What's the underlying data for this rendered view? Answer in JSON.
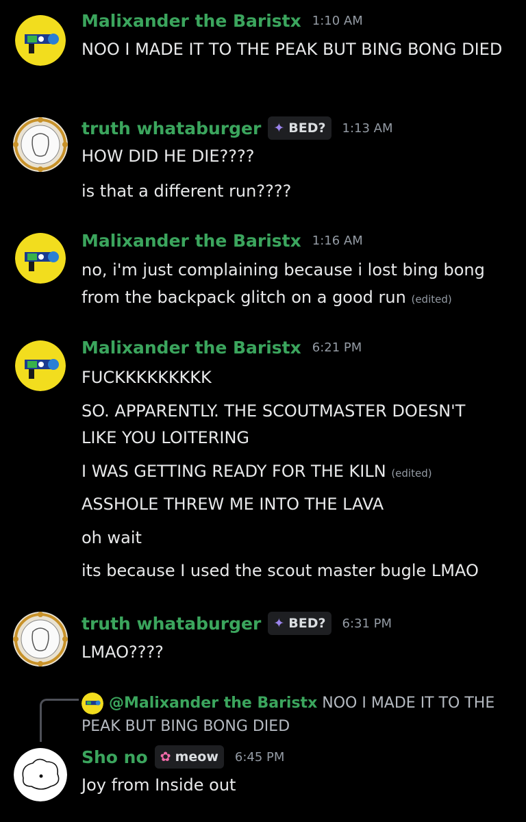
{
  "colors": {
    "background": "#000000",
    "username": "#3ba55d",
    "timestamp": "#949ba4",
    "text": "#e8e9ea",
    "tag_bg": "#1e1f22"
  },
  "messages": [
    {
      "author": "Malixander the Baristx",
      "time": "1:10 AM",
      "lines": [
        "NOO I MADE IT TO THE PEAK BUT BING BONG DIED"
      ]
    },
    {
      "author": "truth whataburger",
      "tag": "BED?",
      "tag_icon": "sparkle-icon",
      "time": "1:13 AM",
      "lines": [
        "HOW DID HE DIE????",
        "is that a different run????"
      ]
    },
    {
      "author": "Malixander the Baristx",
      "time": "1:16 AM",
      "lines": [
        "no, i'm just complaining because i lost bing bong",
        "from the backpack glitch on a good run"
      ],
      "edited": "(edited)"
    },
    {
      "author": "Malixander the Baristx",
      "time": "6:21 PM",
      "lines": [
        "FUCKKKKKKKKK",
        "SO. APPARENTLY. THE SCOUTMASTER DOESN'T",
        "LIKE YOU LOITERING",
        "I WAS GETTING READY FOR THE KILN",
        "ASSHOLE THREW ME INTO THE LAVA",
        "oh wait",
        "its because I used the scout master bugle LMAO"
      ],
      "edited": "(edited)"
    },
    {
      "author": "truth whataburger",
      "tag": "BED?",
      "tag_icon": "sparkle-icon",
      "time": "6:31 PM",
      "lines": [
        "LMAO????"
      ]
    },
    {
      "reply": {
        "mention": "@Malixander the Baristx",
        "text_line1": "NOO I MADE IT TO THE",
        "text_line2": "PEAK BUT BING BONG DIED"
      },
      "author": "Sho no",
      "tag": "meow",
      "tag_icon": "cat-icon",
      "time": "6:45 PM",
      "lines": [
        "Joy from Inside out"
      ]
    }
  ]
}
